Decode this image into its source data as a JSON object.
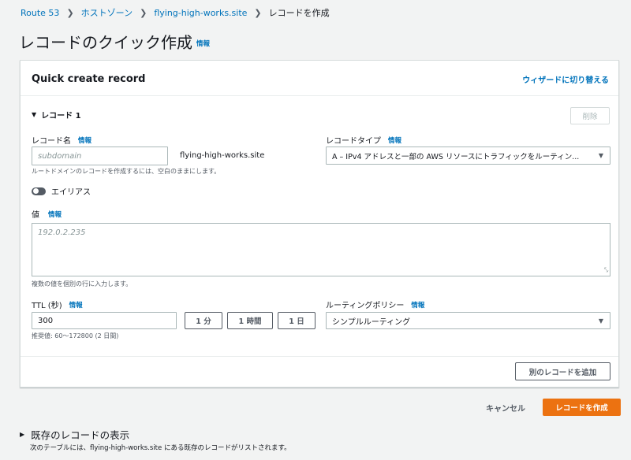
{
  "breadcrumb": [
    "Route 53",
    "ホストゾーン",
    "flying-high-works.site",
    "レコードを作成"
  ],
  "page": {
    "title": "レコードのクイック作成",
    "info": "情報"
  },
  "panel": {
    "title": "Quick create record",
    "wizard_link": "ウィザードに切り替える",
    "record_section": "レコード 1",
    "delete_label": "削除",
    "record_name": {
      "label": "レコード名",
      "info": "情報",
      "placeholder": "subdomain",
      "suffix": "flying-high-works.site",
      "hint": "ルートドメインのレコードを作成するには、空白のままにします。"
    },
    "record_type": {
      "label": "レコードタイプ",
      "info": "情報",
      "value": "A – IPv4 アドレスと一部の AWS リソースにトラフィックをルーティン..."
    },
    "alias": {
      "label": "エイリアス",
      "on": false
    },
    "value": {
      "label": "値",
      "info": "情報",
      "placeholder": "192.0.2.235",
      "hint": "複数の値を個別の行に入力します。"
    },
    "ttl": {
      "label": "TTL (秒)",
      "info": "情報",
      "value": "300",
      "buttons": [
        "1 分",
        "1 時間",
        "1 日"
      ],
      "hint": "推奨値: 60～172800 (2 日間)"
    },
    "routing": {
      "label": "ルーティングポリシー",
      "info": "情報",
      "value": "シンプルルーティング"
    },
    "add_record": "別のレコードを追加"
  },
  "actions": {
    "cancel": "キャンセル",
    "create": "レコードを作成"
  },
  "existing": {
    "title": "既存のレコードの表示",
    "desc_prefix": "次のテーブルには、",
    "desc_domain": "flying-high-works.site",
    "desc_suffix": " にある既存のレコードがリストされます。"
  },
  "colors": {
    "accent": "#0073bb",
    "primary": "#ec7211",
    "background": "#f2f3f3"
  }
}
